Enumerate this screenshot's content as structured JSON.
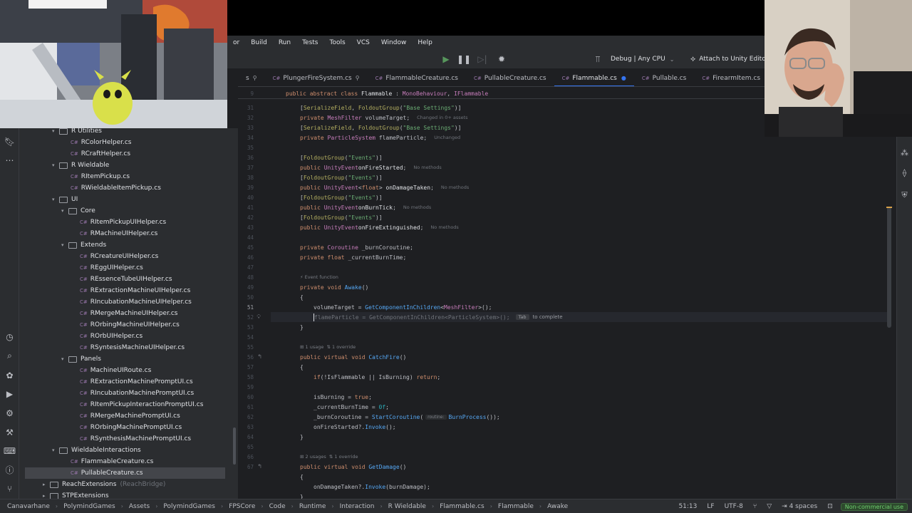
{
  "menu": [
    "or",
    "Build",
    "Run",
    "Tests",
    "Tools",
    "VCS",
    "Window",
    "Help"
  ],
  "toolbar": {
    "run_config": "Debug | Any CPU",
    "attach_label": "Attach to Unity Editor"
  },
  "tabs": [
    {
      "label": "s",
      "pinned": true,
      "active": false,
      "prefix": false
    },
    {
      "label": "PlungerFireSystem.cs",
      "pinned": true,
      "active": false,
      "prefix": true
    },
    {
      "label": "FlammableCreature.cs",
      "pinned": false,
      "active": false,
      "prefix": true
    },
    {
      "label": "PullableCreature.cs",
      "pinned": false,
      "active": false,
      "prefix": true
    },
    {
      "label": "Flammable.cs",
      "pinned": false,
      "active": true,
      "prefix": true,
      "modified": true
    },
    {
      "label": "Pullable.cs",
      "pinned": false,
      "active": false,
      "prefix": true
    },
    {
      "label": "FirearmItem.cs",
      "pinned": false,
      "active": false,
      "prefix": true
    },
    {
      "label": "Fir",
      "pinned": false,
      "active": false,
      "prefix": true
    }
  ],
  "cs_badge": "C#",
  "project_tree": [
    {
      "label": "R Utilities",
      "indent": 73,
      "type": "folder",
      "open": true
    },
    {
      "label": "RColorHelper.cs",
      "indent": 99,
      "type": "file"
    },
    {
      "label": "RCraftHelper.cs",
      "indent": 99,
      "type": "file"
    },
    {
      "label": "R Wieldable",
      "indent": 73,
      "type": "folder",
      "open": true
    },
    {
      "label": "RItemPickup.cs",
      "indent": 99,
      "type": "file"
    },
    {
      "label": "RWieldableItemPickup.cs",
      "indent": 99,
      "type": "file"
    },
    {
      "label": "UI",
      "indent": 73,
      "type": "folder",
      "open": true
    },
    {
      "label": "Core",
      "indent": 86,
      "type": "folder",
      "open": true
    },
    {
      "label": "RItemPickupUIHelper.cs",
      "indent": 112,
      "type": "file"
    },
    {
      "label": "RMachineUIHelper.cs",
      "indent": 112,
      "type": "file"
    },
    {
      "label": "Extends",
      "indent": 86,
      "type": "folder",
      "open": true
    },
    {
      "label": "RCreatureUIHelper.cs",
      "indent": 112,
      "type": "file"
    },
    {
      "label": "REggUIHelper.cs",
      "indent": 112,
      "type": "file"
    },
    {
      "label": "REssenceTubeUIHelper.cs",
      "indent": 112,
      "type": "file"
    },
    {
      "label": "RExtractionMachineUIHelper.cs",
      "indent": 112,
      "type": "file"
    },
    {
      "label": "RIncubationMachineUIHelper.cs",
      "indent": 112,
      "type": "file"
    },
    {
      "label": "RMergeMachineUIHelper.cs",
      "indent": 112,
      "type": "file"
    },
    {
      "label": "ROrbingMachineUIHelper.cs",
      "indent": 112,
      "type": "file"
    },
    {
      "label": "ROrbUIHelper.cs",
      "indent": 112,
      "type": "file"
    },
    {
      "label": "RSyntesisMachineUIHelper.cs",
      "indent": 112,
      "type": "file"
    },
    {
      "label": "Panels",
      "indent": 86,
      "type": "folder",
      "open": true
    },
    {
      "label": "MachineUIRoute.cs",
      "indent": 112,
      "type": "file"
    },
    {
      "label": "RExtractionMachinePromptUI.cs",
      "indent": 112,
      "type": "file"
    },
    {
      "label": "RIncubationMachinePromptUI.cs",
      "indent": 112,
      "type": "file"
    },
    {
      "label": "RItemPickupInteractionPromptUI.cs",
      "indent": 112,
      "type": "file"
    },
    {
      "label": "RMergeMachinePromptUI.cs",
      "indent": 112,
      "type": "file"
    },
    {
      "label": "ROrbingMachinePromptUI.cs",
      "indent": 112,
      "type": "file"
    },
    {
      "label": "RSynthesisMachinePromptUI.cs",
      "indent": 112,
      "type": "file"
    },
    {
      "label": "WieldableInteractions",
      "indent": 73,
      "type": "folder",
      "open": true
    },
    {
      "label": "FlammableCreature.cs",
      "indent": 99,
      "type": "file"
    },
    {
      "label": "PullableCreature.cs",
      "indent": 99,
      "type": "file",
      "selected": true
    },
    {
      "label": "ReachExtensions",
      "indent": 60,
      "type": "folder",
      "open": false,
      "hint": "(ReachBridge)"
    },
    {
      "label": "STPExtensions",
      "indent": 60,
      "type": "folder",
      "open": false
    }
  ],
  "sticky": {
    "line": "9",
    "pre": "public abstract class ",
    "cls": "Flammable",
    "mid": " : ",
    "base": "MonoBehaviour",
    "sep": ", ",
    "iface": "IFlammable"
  },
  "code": {
    "line_numbers": [
      "31",
      "32",
      "33",
      "34",
      "35",
      "36",
      "37",
      "38",
      "39",
      "40",
      "41",
      "42",
      "43",
      "44",
      "45",
      "46",
      "47",
      "48",
      "49",
      "50",
      "51",
      "52",
      "53",
      "54",
      "55",
      "56",
      "57",
      "58",
      "59",
      "60",
      "61",
      "62",
      "63",
      "64",
      "65",
      "66",
      "67"
    ],
    "current_line": "51",
    "hints": {
      "changed": "Changed in 0+ assets",
      "unchanged": "Unchanged",
      "no_methods": "No methods",
      "event_function": "Event function",
      "usage_1": "1 usage",
      "override_1": "1 override",
      "usages_2": "2 usages",
      "routine": "routine:",
      "tab_key": "Tab",
      "to_complete": "to complete"
    }
  },
  "status": {
    "breadcrumbs": [
      "Canavarhane",
      "PolymindGames",
      "Assets",
      "PolymindGames",
      "FPSCore",
      "Code",
      "Runtime",
      "Interaction",
      "R Wieldable",
      "Flammable.cs",
      "Flammable",
      "Awake"
    ],
    "position": "51:13",
    "line_ending": "LF",
    "encoding": "UTF-8",
    "indent": "4 spaces",
    "license": "Non-commercial use"
  }
}
